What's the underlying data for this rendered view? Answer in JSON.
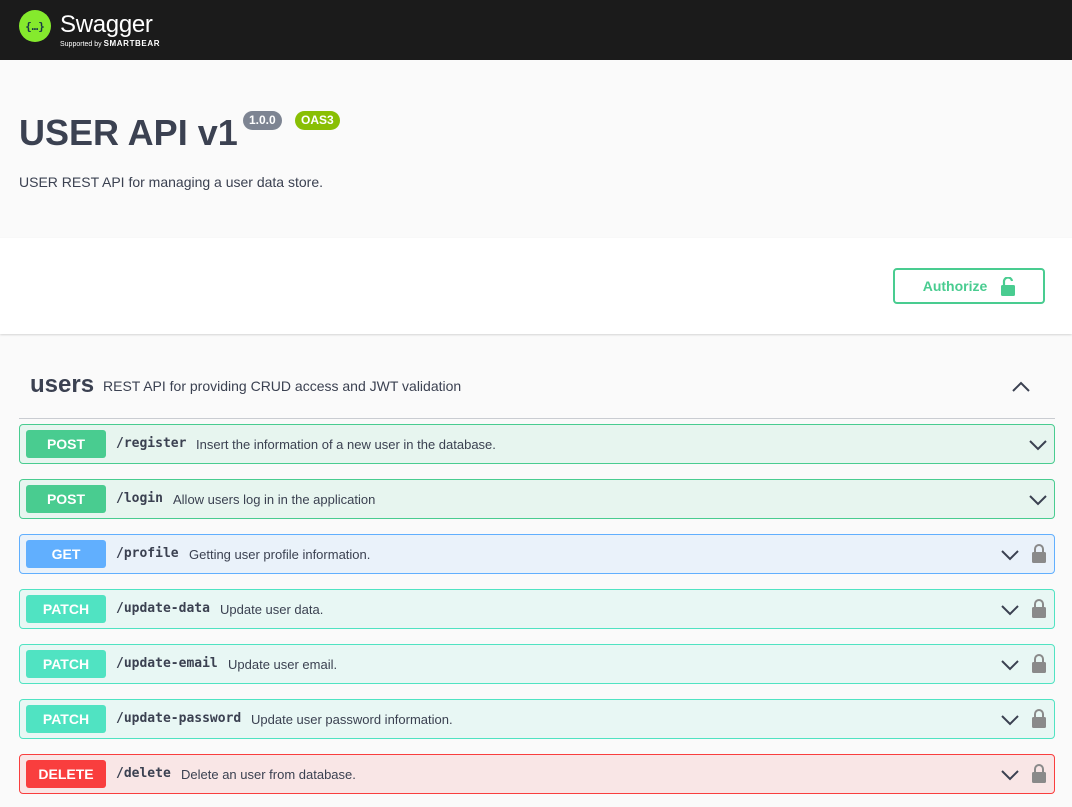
{
  "brand": {
    "name": "Swagger",
    "sub_prefix": "Supported by",
    "sub_company": "SMARTBEAR",
    "logo_glyph": "{…}",
    "color": "#85ea2d"
  },
  "info": {
    "title": "USER API v1",
    "version_badge": "1.0.0",
    "oas_badge": "OAS3",
    "description": "USER REST API for managing a user data store."
  },
  "scheme": {
    "authorize_label": "Authorize",
    "authorize_icon": "unlock-icon"
  },
  "tag": {
    "name": "users",
    "description": "REST API for providing CRUD access and JWT validation",
    "toggle_icon": "chevron-up-icon"
  },
  "operations": [
    {
      "method": "POST",
      "path": "/register",
      "summary": "Insert the information of a new user in the database.",
      "locked": false
    },
    {
      "method": "POST",
      "path": "/login",
      "summary": "Allow users log in in the application",
      "locked": false
    },
    {
      "method": "GET",
      "path": "/profile",
      "summary": "Getting user profile information.",
      "locked": true
    },
    {
      "method": "PATCH",
      "path": "/update-data",
      "summary": "Update user data.",
      "locked": true
    },
    {
      "method": "PATCH",
      "path": "/update-email",
      "summary": "Update user email.",
      "locked": true
    },
    {
      "method": "PATCH",
      "path": "/update-password",
      "summary": "Update user password information.",
      "locked": true
    },
    {
      "method": "DELETE",
      "path": "/delete",
      "summary": "Delete an user from database.",
      "locked": true
    }
  ],
  "colors": {
    "post": "#49cc90",
    "get": "#61affe",
    "patch": "#50e3c2",
    "delete": "#f93e3e",
    "topbar": "#1b1b1b"
  }
}
